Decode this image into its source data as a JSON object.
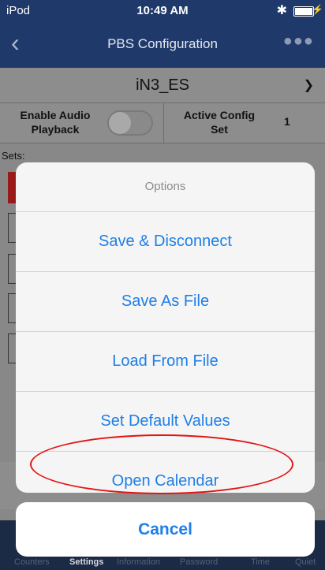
{
  "status_bar": {
    "carrier": "iPod",
    "time": "10:49 AM",
    "bluetooth_icon": "bluetooth-icon",
    "battery_icon": "battery-charging-icon"
  },
  "nav": {
    "back_icon": "chevron-left-icon",
    "title": "PBS Configuration",
    "more_icon": "ellipsis-icon"
  },
  "profile": {
    "selected": "iN3_ES",
    "chevron_icon": "chevron-down-icon"
  },
  "config": {
    "audio_label": "Enable Audio Playback",
    "audio_enabled": false,
    "active_label": "Active Config Set",
    "active_value": "1"
  },
  "sets_label": "Sets:",
  "action_sheet": {
    "title": "Options",
    "options": [
      "Save & Disconnect",
      "Save As File",
      "Load From File",
      "Set Default Values",
      "Open Calendar"
    ],
    "cancel": "Cancel",
    "highlighted_option": "Open Calendar"
  },
  "tabs": [
    {
      "label": "Counters",
      "active": false
    },
    {
      "label": "Settings",
      "active": true
    },
    {
      "label": "Information",
      "active": false
    },
    {
      "label": "Password",
      "active": false
    },
    {
      "label": "Time",
      "active": false
    },
    {
      "label": "Quiet",
      "active": false
    }
  ],
  "colors": {
    "nav_bg": "#1f3a6a",
    "ios_blue": "#1e7fe6",
    "highlight_red": "#e31414"
  }
}
